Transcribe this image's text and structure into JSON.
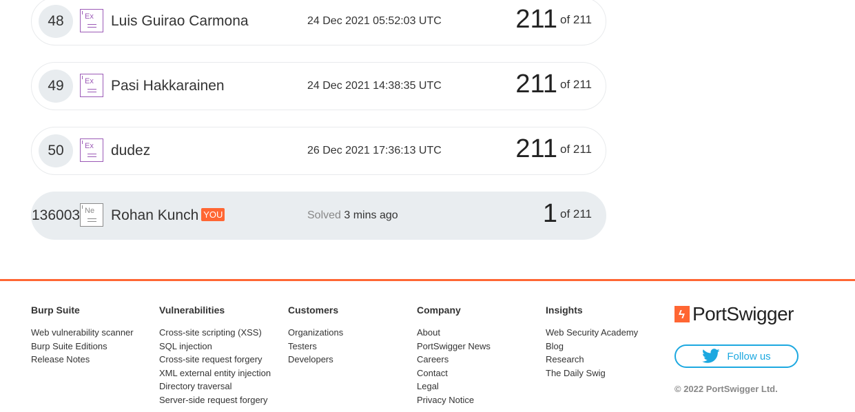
{
  "leaderboard": [
    {
      "rank": "48",
      "badge": "Ex",
      "name": "Luis Guirao Carmona",
      "date": "24 Dec 2021 05:52:03 UTC",
      "score": "211",
      "of": "of 211"
    },
    {
      "rank": "49",
      "badge": "Ex",
      "name": "Pasi Hakkarainen",
      "date": "24 Dec 2021 14:38:35 UTC",
      "score": "211",
      "of": "of 211"
    },
    {
      "rank": "50",
      "badge": "Ex",
      "name": "dudez",
      "date": "26 Dec 2021 17:36:13 UTC",
      "score": "211",
      "of": "of 211"
    }
  ],
  "current_user": {
    "rank": "136003",
    "badge": "Ne",
    "name": "Rohan Kunch",
    "you_label": "YOU",
    "solved_label": "Solved",
    "solved_time": "3 mins ago",
    "score": "1",
    "of": "of 211"
  },
  "footer": {
    "columns": [
      {
        "title": "Burp Suite",
        "links": [
          "Web vulnerability scanner",
          "Burp Suite Editions",
          "Release Notes"
        ]
      },
      {
        "title": "Vulnerabilities",
        "links": [
          "Cross-site scripting (XSS)",
          "SQL injection",
          "Cross-site request forgery",
          "XML external entity injection",
          "Directory traversal",
          "Server-side request forgery"
        ]
      },
      {
        "title": "Customers",
        "links": [
          "Organizations",
          "Testers",
          "Developers"
        ]
      },
      {
        "title": "Company",
        "links": [
          "About",
          "PortSwigger News",
          "Careers",
          "Contact",
          "Legal",
          "Privacy Notice"
        ]
      },
      {
        "title": "Insights",
        "links": [
          "Web Security Academy",
          "Blog",
          "Research",
          "The Daily Swig"
        ]
      }
    ],
    "logo_text": "PortSwigger",
    "follow_label": "Follow us",
    "copyright": "© 2022 PortSwigger Ltd.",
    "accent_color": "#ff6633",
    "twitter_color": "#1ca8e0"
  }
}
